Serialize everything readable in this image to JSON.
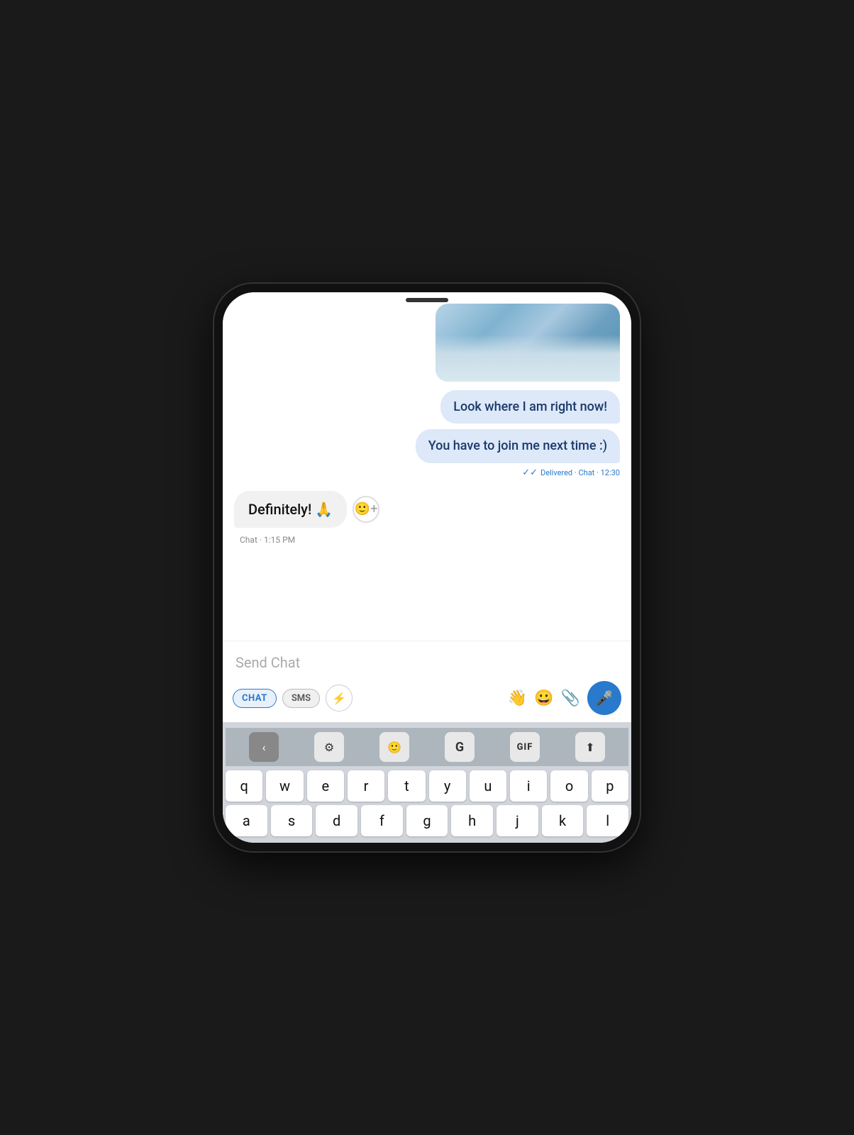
{
  "phone": {
    "messages": {
      "sent_1": "Look where I am right now!",
      "sent_2": "You have to join me next time :)",
      "status": "Delivered · Chat · 12:30",
      "received_1": "Definitely! 🙏",
      "received_meta": "Chat · 1:15 PM"
    },
    "input": {
      "placeholder": "Send Chat"
    },
    "toolbar": {
      "chat_label": "CHAT",
      "sms_label": "SMS"
    },
    "keyboard": {
      "row1": [
        "q",
        "w",
        "e",
        "r",
        "t",
        "y",
        "u",
        "i",
        "o",
        "p"
      ],
      "row2": [
        "a",
        "s",
        "d",
        "f",
        "g",
        "h",
        "j",
        "k",
        "l"
      ]
    }
  }
}
